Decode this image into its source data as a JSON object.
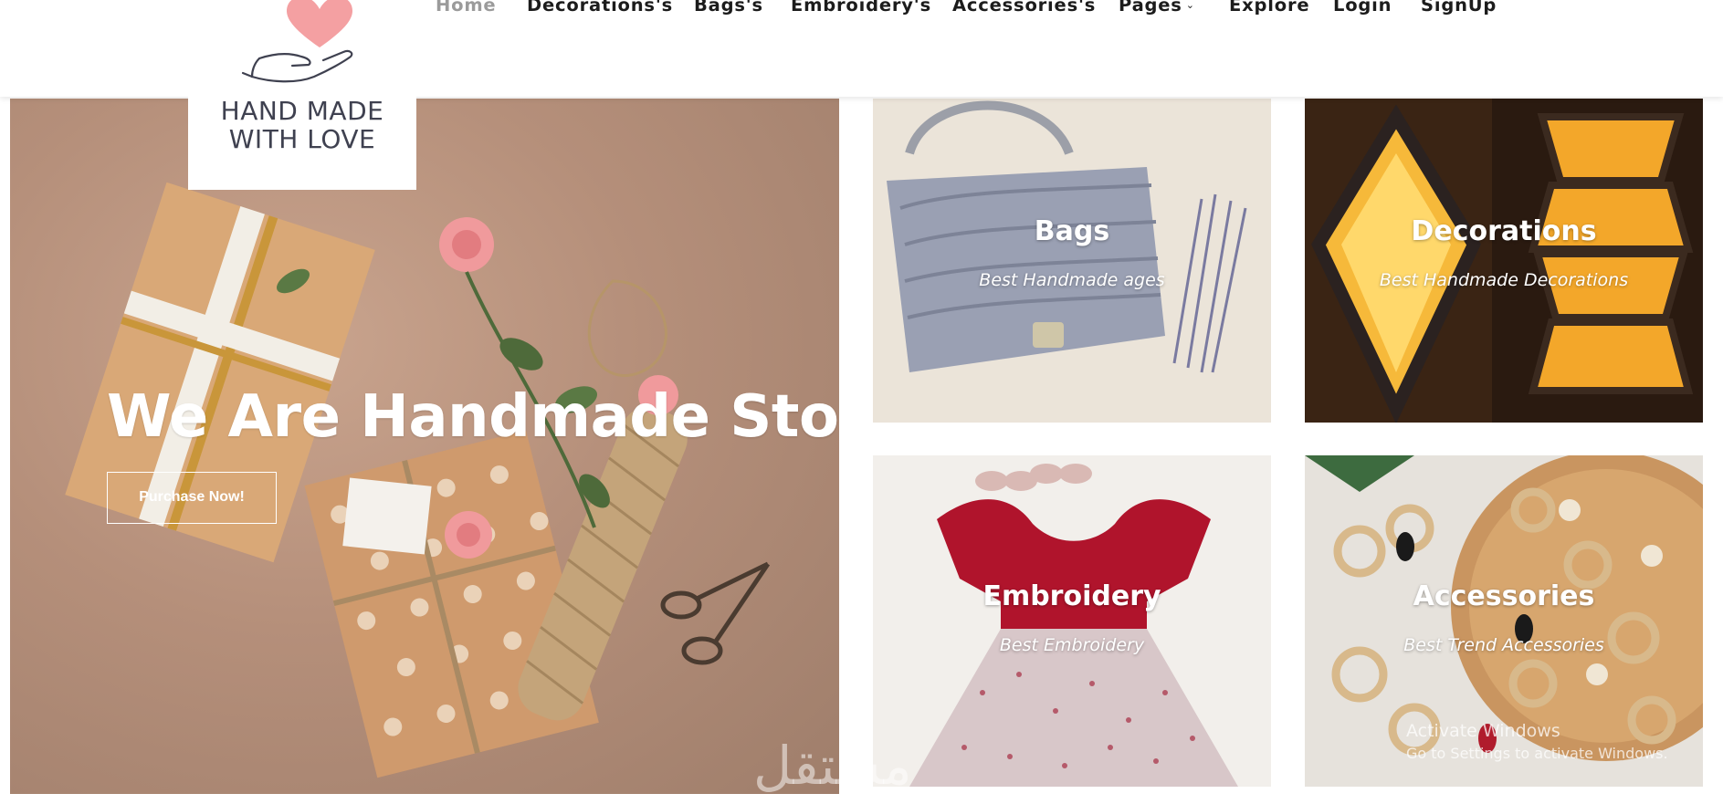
{
  "nav": {
    "items": [
      {
        "label": "Home",
        "active": true
      },
      {
        "label": "Decorations's",
        "active": false
      },
      {
        "label": "Bags's",
        "active": false
      },
      {
        "label": "Embroidery's",
        "active": false
      },
      {
        "label": "Accessories's",
        "active": false
      },
      {
        "label": "Pages",
        "active": false,
        "has_dropdown": true
      },
      {
        "label": "Explore",
        "active": false
      },
      {
        "label": "Login",
        "active": false
      },
      {
        "label": "SignUp",
        "active": false
      }
    ],
    "caret_icon": "chevron-down-icon"
  },
  "logo": {
    "line1": "HAND MADE",
    "line2": "WITH LOVE",
    "icons": [
      "heart-icon",
      "open-hand-icon"
    ],
    "heart_color": "#f4a0a2"
  },
  "hero": {
    "title": "We Are Handmade Store",
    "button_label": "Purchase Now!"
  },
  "categories": [
    {
      "title": "Bags",
      "subtitle": "Best Handmade ages"
    },
    {
      "title": "Decorations",
      "subtitle": "Best Handmade Decorations"
    },
    {
      "title": "Embroidery",
      "subtitle": "Best Embroidery"
    },
    {
      "title": "Accessories",
      "subtitle": "Best Trend Accessories"
    }
  ],
  "watermark": "مستقل",
  "os_overlay": {
    "line1": "Activate Windows",
    "line2": "Go to Settings to activate Windows."
  },
  "colors": {
    "nav_text": "#1c1c1c",
    "nav_active": "#9b9b9b",
    "logo_text": "#3f4150",
    "hero_bg": "#b58f7a"
  }
}
